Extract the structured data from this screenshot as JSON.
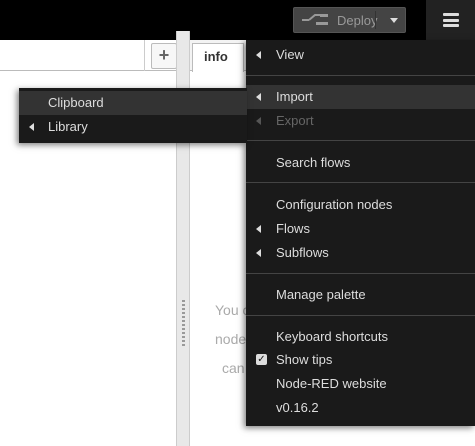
{
  "header": {
    "deploy_label": "Deploy"
  },
  "workspace": {
    "add_tab_label": "+"
  },
  "sidebar": {
    "active_tab": "info",
    "info_text": [
      "You c",
      "node",
      "can"
    ]
  },
  "main_menu": {
    "items": [
      {
        "label": "View",
        "has_submenu": true,
        "disabled": false
      },
      {
        "label": "Import",
        "has_submenu": true,
        "disabled": false,
        "active": true
      },
      {
        "label": "Export",
        "has_submenu": true,
        "disabled": true
      },
      {
        "label": "Search flows",
        "has_submenu": false,
        "disabled": false
      },
      {
        "label": "Configuration nodes",
        "has_submenu": false,
        "disabled": false
      },
      {
        "label": "Flows",
        "has_submenu": true,
        "disabled": false
      },
      {
        "label": "Subflows",
        "has_submenu": true,
        "disabled": false
      },
      {
        "label": "Manage palette",
        "has_submenu": false,
        "disabled": false
      },
      {
        "label": "Keyboard shortcuts",
        "has_submenu": false,
        "disabled": false
      },
      {
        "label": "Show tips",
        "has_submenu": false,
        "checked": true
      },
      {
        "label": "Node-RED website",
        "has_submenu": false,
        "disabled": false
      },
      {
        "label": "v0.16.2",
        "has_submenu": false,
        "disabled": false
      }
    ]
  },
  "import_submenu": {
    "items": [
      {
        "label": "Clipboard",
        "has_submenu": false,
        "active": true
      },
      {
        "label": "Library",
        "has_submenu": true
      }
    ]
  },
  "colors": {
    "menu_bg": "#1a1a1a",
    "menu_text": "#dddddd",
    "menu_active": "#333333",
    "header_bg": "#000000"
  },
  "icons": {
    "deploy": "deploy-flow-icon",
    "menu": "hamburger-icon",
    "submenu": "caret-left-icon",
    "check": "checkbox-icon"
  }
}
